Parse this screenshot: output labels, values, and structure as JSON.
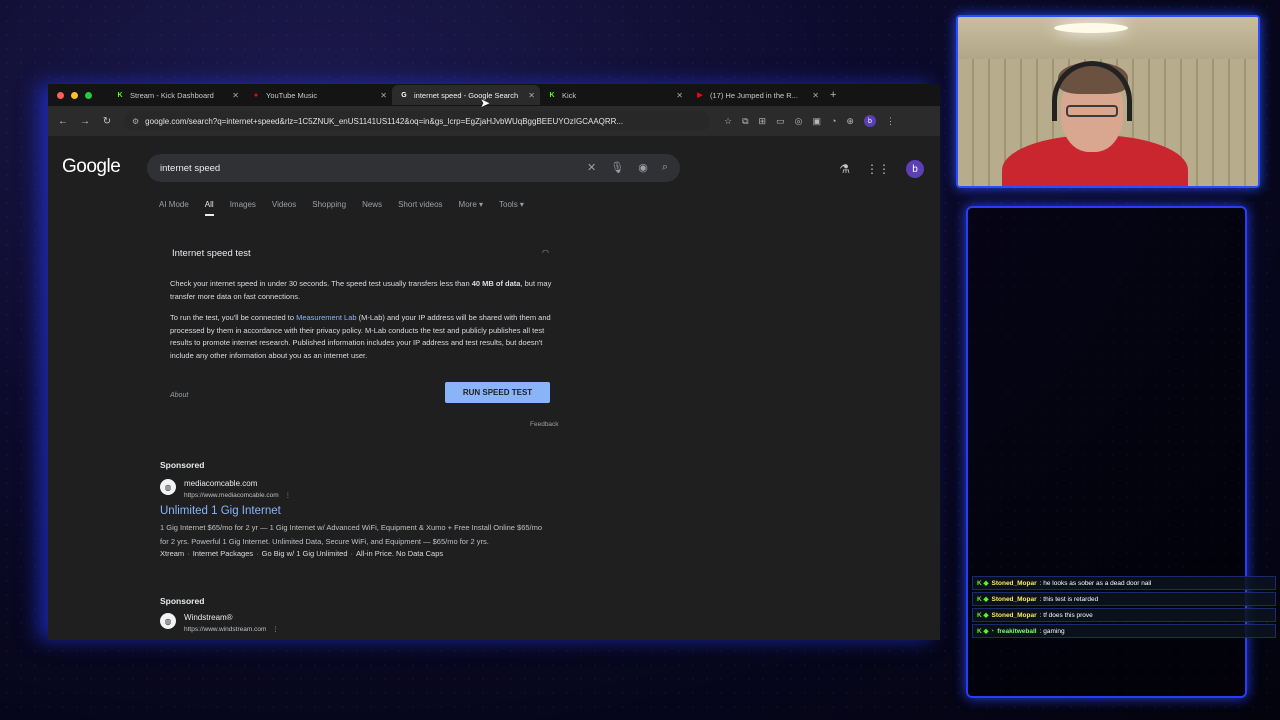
{
  "tabs": [
    {
      "label": "Stream - Kick Dashboard",
      "favicon": "kick-icon",
      "color": "#53fc18",
      "active": false
    },
    {
      "label": "YouTube Music",
      "favicon": "youtube-music-icon",
      "color": "#ff0000",
      "active": false
    },
    {
      "label": "internet speed - Google Search",
      "favicon": "google-icon",
      "color": "#ffffff",
      "active": true
    },
    {
      "label": "Kick",
      "favicon": "kick-icon",
      "color": "#53fc18",
      "active": false
    },
    {
      "label": "(17) He Jumped in the R...",
      "favicon": "youtube-icon",
      "color": "#ff0000",
      "active": false
    }
  ],
  "toolbar": {
    "url": "google.com/search?q=internet+speed&rlz=1C5ZNUK_enUS1141US1142&oq=in&gs_lcrp=EgZjaHJvbWUqBggBEEUYOzIGCAAQRR...",
    "profile_initial": "b"
  },
  "google": {
    "logo": "Google",
    "query": "internet speed",
    "avatar_initial": "b",
    "filters": [
      "AI Mode",
      "All",
      "Images",
      "Videos",
      "Shopping",
      "News",
      "Short videos",
      "More ▾",
      "Tools ▾"
    ],
    "active_filter": "All"
  },
  "speed_test": {
    "title": "Internet speed test",
    "para1_a": "Check your internet speed in under 30 seconds. The speed test usually transfers less than ",
    "para1_bold": "40 MB of data",
    "para1_b": ", but may transfer more data on fast connections.",
    "para2_a": "To run the test, you'll be connected to ",
    "para2_link1": "Measurement Lab",
    "para2_b": " (M-Lab) and your IP address will be shared with them and processed by them in accordance with their ",
    "para2_link2": "privacy policy",
    "para2_c": ". M-Lab conducts the test and publicly publishes all test results to promote internet research. Published information includes your IP address and test results, but doesn't include any other information about you as an internet user.",
    "about": "About",
    "run_button": "RUN SPEED TEST",
    "feedback": "Feedback"
  },
  "ads": [
    {
      "label": "Sponsored",
      "site": "mediacomcable.com",
      "url": "https://www.mediacomcable.com",
      "headline": "Unlimited 1 Gig Internet",
      "desc": "1 Gig Internet $65/mo for 2 yr — 1 Gig Internet w/ Advanced WiFi, Equipment & Xumo + Free Install Online $65/mo for 2 yrs. Powerful 1 Gig Internet. Unlimited Data, Secure WiFi, and Equipment — $65/mo for 2 yrs.",
      "links": [
        "Xtream",
        "Internet Packages",
        "Go Big w/ 1 Gig Unlimited",
        "All-in Price. No Data Caps"
      ]
    },
    {
      "label": "Sponsored",
      "site": "Windstream®",
      "url": "https://www.windstream.com"
    }
  ],
  "chat": [
    {
      "user": "Stoned_Mopar",
      "text": ": he looks as sober as a dead door nail",
      "user_color": "#ffea61"
    },
    {
      "user": "Stoned_Mopar",
      "text": ": this test is retarded",
      "user_color": "#ffea61"
    },
    {
      "user": "Stoned_Mopar",
      "text": ": tf does this prove",
      "user_color": "#ffea61"
    },
    {
      "user": "freakitweball",
      "text": ": gaming",
      "user_color": "#7cff6a"
    }
  ]
}
